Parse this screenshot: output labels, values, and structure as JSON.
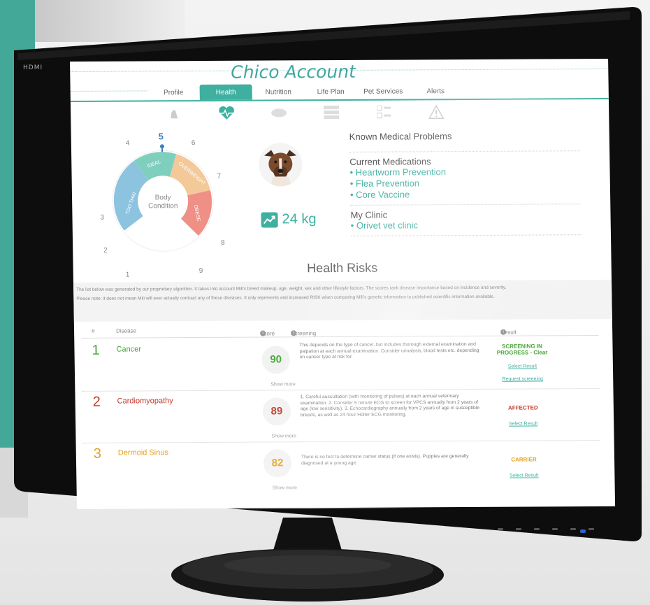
{
  "monitor": {
    "brand_label": "HDMI"
  },
  "account": {
    "title": "Chico Account"
  },
  "tabs": [
    {
      "label": "Profile",
      "icon": "dog-icon"
    },
    {
      "label": "Health",
      "icon": "heartbeat-icon"
    },
    {
      "label": "Nutrition",
      "icon": "food-bowl-icon"
    },
    {
      "label": "Life Plan",
      "icon": "table-icon"
    },
    {
      "label": "Pet Services",
      "icon": "checklist-icon"
    },
    {
      "label": "Alerts",
      "icon": "warning-icon"
    }
  ],
  "body_condition": {
    "center_label": "Body Condition",
    "current_score": "5",
    "scale_numbers": [
      "1",
      "2",
      "3",
      "4",
      "5",
      "6",
      "7",
      "8",
      "9"
    ],
    "segments": [
      "TOO THIN",
      "IDEAL",
      "OVERWEIGHT",
      "OBESE"
    ],
    "colors": {
      "too_thin": "#8cc3df",
      "ideal": "#7fcfbf",
      "overweight": "#f3c99a",
      "obese": "#ef8f86"
    }
  },
  "pet": {
    "weight": "24 kg"
  },
  "medical": {
    "known_problems_heading": "Known Medical Problems",
    "medications_heading": "Current Medications",
    "medications": [
      "• Heartworm Prevention",
      "• Flea Prevention",
      "• Core Vaccine"
    ],
    "clinic_heading": "My Clinic",
    "clinic": "• Orivet vet clinic"
  },
  "health_risks": {
    "title": "Health Risks",
    "notice_1": "The list below was generated by our proprietary algorithm. It takes into account Mili's breed makeup, age, weight, sex and other lifestyle factors. The scores rank disease importance based on incidence and severity.",
    "notice_2": "Please note: it does not mean Mili will ever actually contract any of these diseases. It only represents and increased RISK when comparing Mili's genetic information to published scientific information available.",
    "columns": {
      "num": "#",
      "disease": "Disease",
      "score": "Score",
      "screening": "Screening",
      "result": "Result"
    },
    "rows": [
      {
        "num": "1",
        "disease": "Cancer",
        "score": "90",
        "screening": "This depends on the type of cancer, but includes thorough external examination and palpation at each annual examination. Consider urinalysis, blood tests etc. depending on cancer type at risk for.",
        "status": "SCREENING IN PROGRESS - Clear",
        "select": "Select Result",
        "request": "Request screening",
        "more": "Show more",
        "color": "#4aa63a"
      },
      {
        "num": "2",
        "disease": "Cardiomyopathy",
        "score": "89",
        "screening": "1. Careful auscultation (with monitoring of pulses) at each annual veterinary examination. 2. Consider 5 minute ECG to screen for VPCS annually from 2 years of age (low sensitivity). 3. Echocardiography annually from 2 years of age in susceptible breeds, as well as 24 hour Holter ECG monitoring.",
        "status": "AFFECTED",
        "select": "Select Result",
        "request": "",
        "more": "Show more",
        "color": "#c0392b"
      },
      {
        "num": "3",
        "disease": "Dermoid Sinus",
        "score": "82",
        "screening": "There is no test to determine carrier status (if one exists). Puppies are generally diagnosed at a young age.",
        "status": "CARRIER",
        "select": "Select Result",
        "request": "",
        "more": "Show more",
        "color": "#e5a11c"
      }
    ]
  },
  "colors": {
    "accent": "#3fb0a0",
    "teal_panel": "#44a899"
  }
}
